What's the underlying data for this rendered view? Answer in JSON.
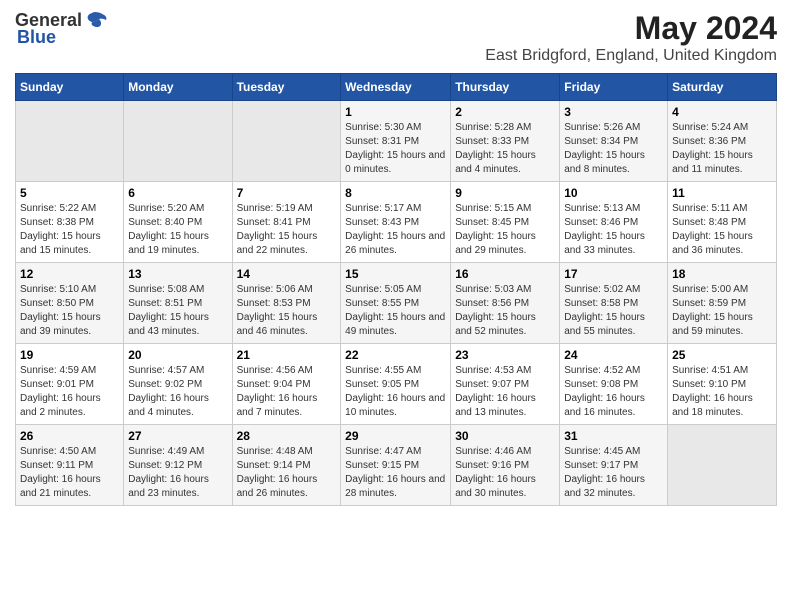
{
  "logo": {
    "general": "General",
    "blue": "Blue"
  },
  "title": "May 2024",
  "subtitle": "East Bridgford, England, United Kingdom",
  "headers": [
    "Sunday",
    "Monday",
    "Tuesday",
    "Wednesday",
    "Thursday",
    "Friday",
    "Saturday"
  ],
  "weeks": [
    [
      {
        "day": "",
        "sunrise": "",
        "sunset": "",
        "daylight": ""
      },
      {
        "day": "",
        "sunrise": "",
        "sunset": "",
        "daylight": ""
      },
      {
        "day": "",
        "sunrise": "",
        "sunset": "",
        "daylight": ""
      },
      {
        "day": "1",
        "sunrise": "Sunrise: 5:30 AM",
        "sunset": "Sunset: 8:31 PM",
        "daylight": "Daylight: 15 hours and 0 minutes."
      },
      {
        "day": "2",
        "sunrise": "Sunrise: 5:28 AM",
        "sunset": "Sunset: 8:33 PM",
        "daylight": "Daylight: 15 hours and 4 minutes."
      },
      {
        "day": "3",
        "sunrise": "Sunrise: 5:26 AM",
        "sunset": "Sunset: 8:34 PM",
        "daylight": "Daylight: 15 hours and 8 minutes."
      },
      {
        "day": "4",
        "sunrise": "Sunrise: 5:24 AM",
        "sunset": "Sunset: 8:36 PM",
        "daylight": "Daylight: 15 hours and 11 minutes."
      }
    ],
    [
      {
        "day": "5",
        "sunrise": "Sunrise: 5:22 AM",
        "sunset": "Sunset: 8:38 PM",
        "daylight": "Daylight: 15 hours and 15 minutes."
      },
      {
        "day": "6",
        "sunrise": "Sunrise: 5:20 AM",
        "sunset": "Sunset: 8:40 PM",
        "daylight": "Daylight: 15 hours and 19 minutes."
      },
      {
        "day": "7",
        "sunrise": "Sunrise: 5:19 AM",
        "sunset": "Sunset: 8:41 PM",
        "daylight": "Daylight: 15 hours and 22 minutes."
      },
      {
        "day": "8",
        "sunrise": "Sunrise: 5:17 AM",
        "sunset": "Sunset: 8:43 PM",
        "daylight": "Daylight: 15 hours and 26 minutes."
      },
      {
        "day": "9",
        "sunrise": "Sunrise: 5:15 AM",
        "sunset": "Sunset: 8:45 PM",
        "daylight": "Daylight: 15 hours and 29 minutes."
      },
      {
        "day": "10",
        "sunrise": "Sunrise: 5:13 AM",
        "sunset": "Sunset: 8:46 PM",
        "daylight": "Daylight: 15 hours and 33 minutes."
      },
      {
        "day": "11",
        "sunrise": "Sunrise: 5:11 AM",
        "sunset": "Sunset: 8:48 PM",
        "daylight": "Daylight: 15 hours and 36 minutes."
      }
    ],
    [
      {
        "day": "12",
        "sunrise": "Sunrise: 5:10 AM",
        "sunset": "Sunset: 8:50 PM",
        "daylight": "Daylight: 15 hours and 39 minutes."
      },
      {
        "day": "13",
        "sunrise": "Sunrise: 5:08 AM",
        "sunset": "Sunset: 8:51 PM",
        "daylight": "Daylight: 15 hours and 43 minutes."
      },
      {
        "day": "14",
        "sunrise": "Sunrise: 5:06 AM",
        "sunset": "Sunset: 8:53 PM",
        "daylight": "Daylight: 15 hours and 46 minutes."
      },
      {
        "day": "15",
        "sunrise": "Sunrise: 5:05 AM",
        "sunset": "Sunset: 8:55 PM",
        "daylight": "Daylight: 15 hours and 49 minutes."
      },
      {
        "day": "16",
        "sunrise": "Sunrise: 5:03 AM",
        "sunset": "Sunset: 8:56 PM",
        "daylight": "Daylight: 15 hours and 52 minutes."
      },
      {
        "day": "17",
        "sunrise": "Sunrise: 5:02 AM",
        "sunset": "Sunset: 8:58 PM",
        "daylight": "Daylight: 15 hours and 55 minutes."
      },
      {
        "day": "18",
        "sunrise": "Sunrise: 5:00 AM",
        "sunset": "Sunset: 8:59 PM",
        "daylight": "Daylight: 15 hours and 59 minutes."
      }
    ],
    [
      {
        "day": "19",
        "sunrise": "Sunrise: 4:59 AM",
        "sunset": "Sunset: 9:01 PM",
        "daylight": "Daylight: 16 hours and 2 minutes."
      },
      {
        "day": "20",
        "sunrise": "Sunrise: 4:57 AM",
        "sunset": "Sunset: 9:02 PM",
        "daylight": "Daylight: 16 hours and 4 minutes."
      },
      {
        "day": "21",
        "sunrise": "Sunrise: 4:56 AM",
        "sunset": "Sunset: 9:04 PM",
        "daylight": "Daylight: 16 hours and 7 minutes."
      },
      {
        "day": "22",
        "sunrise": "Sunrise: 4:55 AM",
        "sunset": "Sunset: 9:05 PM",
        "daylight": "Daylight: 16 hours and 10 minutes."
      },
      {
        "day": "23",
        "sunrise": "Sunrise: 4:53 AM",
        "sunset": "Sunset: 9:07 PM",
        "daylight": "Daylight: 16 hours and 13 minutes."
      },
      {
        "day": "24",
        "sunrise": "Sunrise: 4:52 AM",
        "sunset": "Sunset: 9:08 PM",
        "daylight": "Daylight: 16 hours and 16 minutes."
      },
      {
        "day": "25",
        "sunrise": "Sunrise: 4:51 AM",
        "sunset": "Sunset: 9:10 PM",
        "daylight": "Daylight: 16 hours and 18 minutes."
      }
    ],
    [
      {
        "day": "26",
        "sunrise": "Sunrise: 4:50 AM",
        "sunset": "Sunset: 9:11 PM",
        "daylight": "Daylight: 16 hours and 21 minutes."
      },
      {
        "day": "27",
        "sunrise": "Sunrise: 4:49 AM",
        "sunset": "Sunset: 9:12 PM",
        "daylight": "Daylight: 16 hours and 23 minutes."
      },
      {
        "day": "28",
        "sunrise": "Sunrise: 4:48 AM",
        "sunset": "Sunset: 9:14 PM",
        "daylight": "Daylight: 16 hours and 26 minutes."
      },
      {
        "day": "29",
        "sunrise": "Sunrise: 4:47 AM",
        "sunset": "Sunset: 9:15 PM",
        "daylight": "Daylight: 16 hours and 28 minutes."
      },
      {
        "day": "30",
        "sunrise": "Sunrise: 4:46 AM",
        "sunset": "Sunset: 9:16 PM",
        "daylight": "Daylight: 16 hours and 30 minutes."
      },
      {
        "day": "31",
        "sunrise": "Sunrise: 4:45 AM",
        "sunset": "Sunset: 9:17 PM",
        "daylight": "Daylight: 16 hours and 32 minutes."
      },
      {
        "day": "",
        "sunrise": "",
        "sunset": "",
        "daylight": ""
      }
    ]
  ]
}
